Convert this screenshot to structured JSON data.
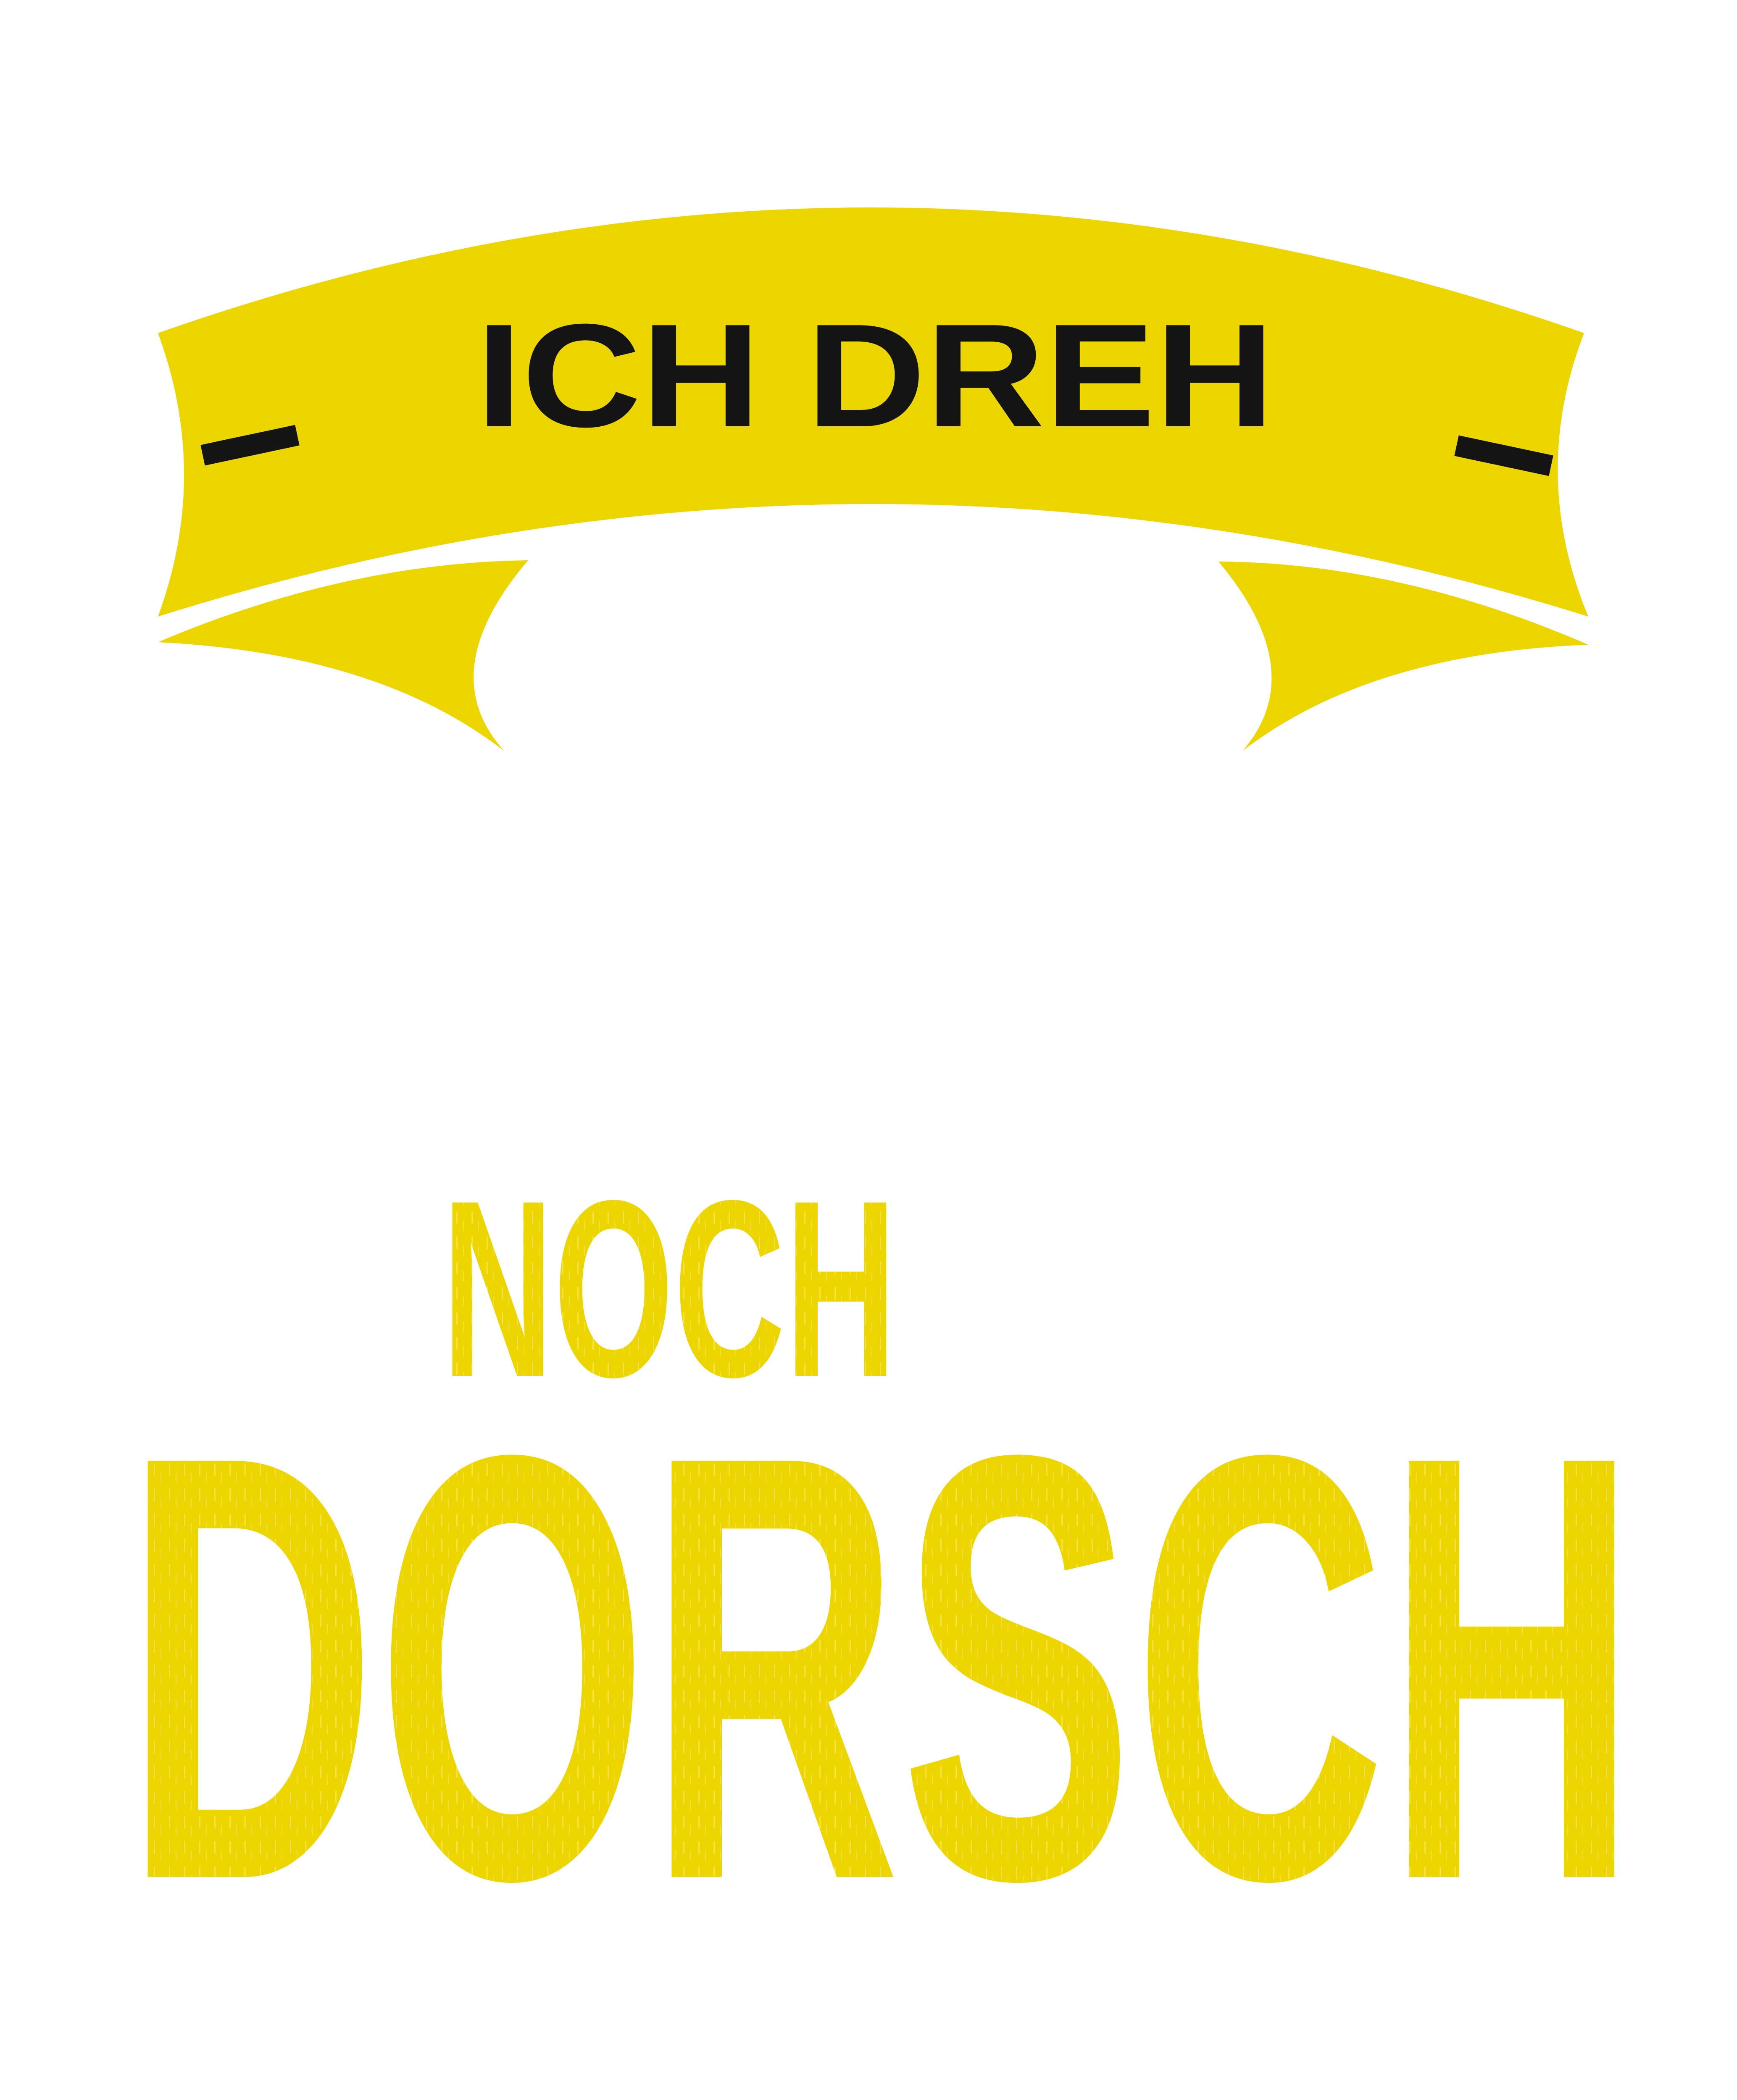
{
  "design": {
    "banner_text": "ICH DREH",
    "line2": "NOCH",
    "line3": "DORSCH"
  },
  "colors": {
    "accent_yellow": "#EDD500",
    "ink_black": "#141414",
    "background": "#FFFFFF"
  }
}
